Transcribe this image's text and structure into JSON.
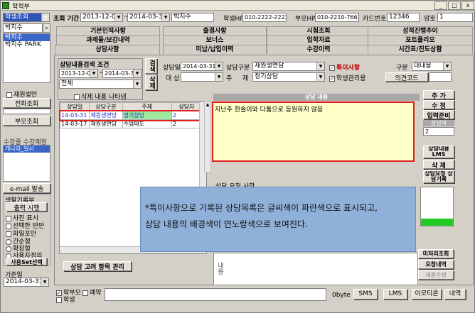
{
  "window": {
    "title": "학적부",
    "min": "_",
    "max": "□",
    "close": "x"
  },
  "left": {
    "mode": "학생조회",
    "search_value": "박지수",
    "results": [
      "박지수",
      "박지수 PARK"
    ],
    "repeat_label": "재원생만",
    "phone_btn": "전화조회",
    "parent_btn": "부모조회",
    "course_label": "수강중 수강예정",
    "course_item": "개나리_일시",
    "email_btn": "e-mail 발송",
    "birthday_label": "생팔기록부",
    "attend_btn": "출력 시행",
    "opts": [
      "사진 표시",
      "선택한 반만",
      "파일포만"
    ],
    "radios": [
      "간순형",
      "확장형",
      "사용자정의"
    ],
    "set_btn": "사용Set선택",
    "base_label": "기준일",
    "base_date": "2014-03-31"
  },
  "top": {
    "period_label": "조회 기간",
    "date_from": "2013-12-01",
    "date_to": "2014-03-31",
    "name": "박지수",
    "student_hp_label": "학생HP",
    "student_hp": "010-2222-2222",
    "parent_hp_label": "부모HP",
    "parent_hp": "010-2210-7663",
    "card_label": "카드번호",
    "card": "12346",
    "pw_label": "암호",
    "pw": "1"
  },
  "tabs_row1": [
    "기본인적사항",
    "출결사항",
    "시험조회",
    "성적진행추이"
  ],
  "tabs_row2": [
    "과제물/보강내역",
    "보너스",
    "입학자료",
    "포트폴리오"
  ],
  "tabs_row3": [
    "상담사항",
    "미납/납입이력",
    "수강이력",
    "시간표/진도상황"
  ],
  "search": {
    "title": "상담내용검색 조건",
    "from": "2013-12-01",
    "to": "2014-03-31",
    "type": "전체",
    "search_btn": "검색",
    "del_btn": "삭제",
    "show_deleted": "삭제 내용 나타냄"
  },
  "form": {
    "date_label": "상담일",
    "date": "2014-03-31",
    "kind_label": "상담구분",
    "kind": "재원생면담",
    "special": "특이사항",
    "division_label": "구분",
    "division": "대내용",
    "target_label": "대 상",
    "subject_label": "주",
    "subject_label2": "제",
    "subject": "정기상담",
    "student_mgmt": "학생관리용",
    "opinion_btn": "의견코드"
  },
  "list": {
    "headers": [
      "상담일",
      "상담구분",
      "주제",
      "상담자"
    ],
    "rows": [
      [
        "14-03-31",
        "재원생면담",
        "정기상담",
        "2"
      ],
      [
        "14-03-17",
        "재원생면담",
        "수업태도",
        "2"
      ]
    ]
  },
  "content": {
    "header": "상담 내용",
    "text": "지난주 한솔이와 다툼으로 등원하지 않음",
    "request_header": "상담 요청 사항",
    "bottom_label": "내용"
  },
  "right_buttons": {
    "add": "추 가",
    "edit": "수 정",
    "input": "입력준비",
    "counselor_label": "상담자",
    "counselor": "2",
    "sms": "상담내용 LMS",
    "delete": "삭 제",
    "request": "상담요청 상담기록",
    "pending": "미처리조회",
    "request_list": "요청내역",
    "content_edit": "내용수정"
  },
  "consult_btn": "상담 고려 항목 관리",
  "footer": {
    "parent": "학부모",
    "student": "학생",
    "reserve": "예약",
    "bytes": "0byte",
    "sms": "SMS",
    "lms": "LMS",
    "emoticon": "이모티콘",
    "history": "내역"
  },
  "tooltip": {
    "line1": "*특이사항으로 기록된 상담목록은 글씨색이 파란색으로 표시되고,",
    "line2": "상담 내용의 배경색이 연노랑색으로 보여진다."
  }
}
